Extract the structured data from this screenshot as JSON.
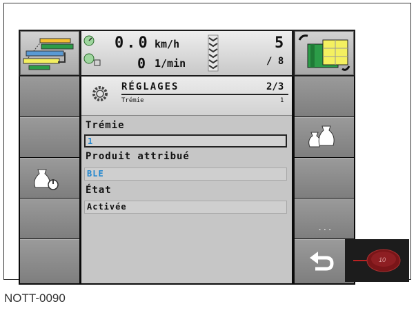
{
  "status": {
    "speed_value": "0.0",
    "speed_unit": "km/h",
    "rpm_value": "0",
    "rpm_unit": "1/min",
    "count_current": "5",
    "count_total": "/ 8"
  },
  "header": {
    "title": "RÉGLAGES",
    "page": "2/3",
    "subtitle": "Trémie",
    "subtitle_value": "1"
  },
  "fields": {
    "hopper_label": "Trémie",
    "hopper_value": "1",
    "product_label": "Produit attribué",
    "product_value": "BLE",
    "state_label": "État",
    "state_value": "Activée"
  },
  "buttons": {
    "more_label": "...",
    "knob_label": "10"
  },
  "caption": "NOTT-0090"
}
